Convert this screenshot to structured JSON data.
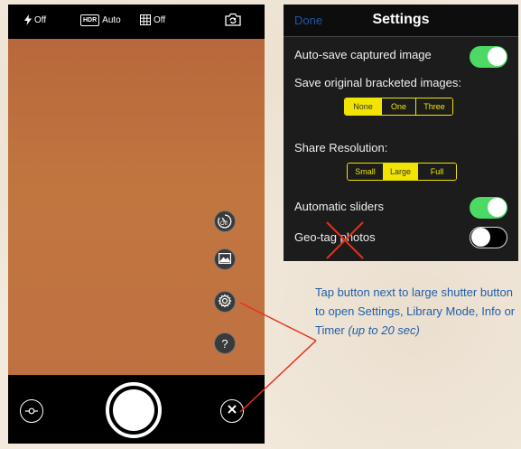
{
  "camera": {
    "flash": {
      "icon": "lightning-icon",
      "label": "Off"
    },
    "hdr": {
      "badge": "HDR",
      "label": "Auto"
    },
    "grid": {
      "icon": "grid-icon",
      "label": "Off"
    },
    "switch_camera_icon": "camera-rotate-icon",
    "side_buttons": [
      {
        "name": "timer-button",
        "icon": "timer-icon",
        "label": "Off"
      },
      {
        "name": "library-button",
        "icon": "image-icon"
      },
      {
        "name": "settings-button",
        "icon": "gear-icon"
      },
      {
        "name": "info-button",
        "icon": "question-icon",
        "glyph": "?"
      }
    ]
  },
  "settings": {
    "done_label": "Done",
    "title": "Settings",
    "autosave_label": "Auto-save captured image",
    "autosave_on": true,
    "bracketed_label": "Save original bracketed images:",
    "bracketed_options": [
      "None",
      "One",
      "Three"
    ],
    "bracketed_selected": "None",
    "share_label": "Share Resolution:",
    "share_options": [
      "Small",
      "Large",
      "Full"
    ],
    "share_selected": "Large",
    "sliders_label": "Automatic sliders",
    "sliders_on": true,
    "geotag_label": "Geo-tag photos",
    "geotag_on": false
  },
  "annotation": {
    "text": "Tap button next to large shutter button to open Settings, Library Mode, Info or Timer",
    "italic": "(up to 20 sec)"
  },
  "colors": {
    "accent_green": "#4cd964",
    "segment_yellow": "#f0e400",
    "annotation_blue": "#1f5fa9",
    "arrow_red": "#e8301c"
  }
}
